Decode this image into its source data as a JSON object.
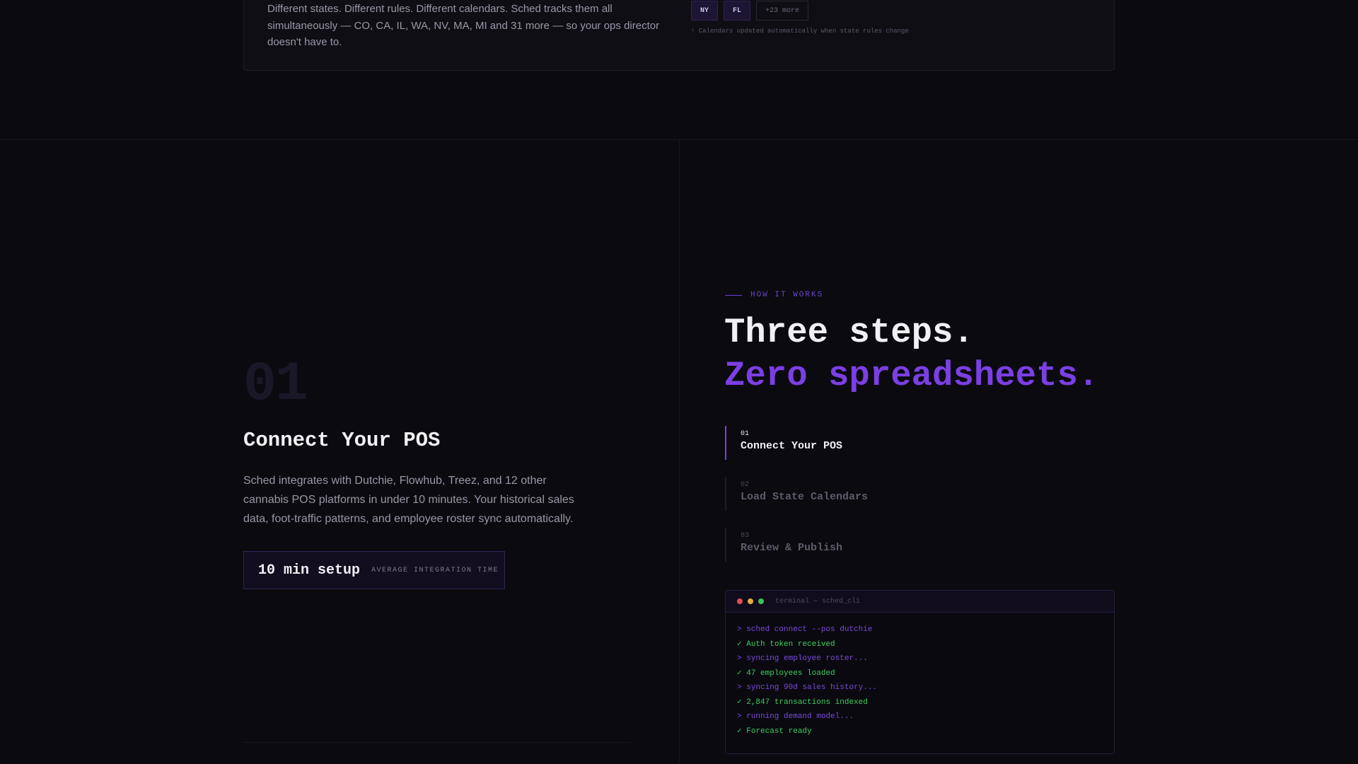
{
  "states_card": {
    "description": "Different states. Different rules. Different calendars. Sched tracks them all simultaneously — CO, CA, IL, WA, NV, MA, MI and 31 more — so your ops director doesn't have to.",
    "chips": [
      "NY",
      "FL"
    ],
    "more_chip": "+23 more",
    "note": "↑ Calendars updated automatically when state rules change"
  },
  "detail": {
    "number": "01",
    "title": "Connect Your POS",
    "description": "Sched integrates with Dutchie, Flowhub, Treez, and 12 other cannabis POS platforms in under 10 minutes. Your historical sales data, foot-traffic patterns, and employee roster sync automatically.",
    "stat_value": "10 min setup",
    "stat_label": "AVERAGE INTEGRATION TIME"
  },
  "how": {
    "eyebrow": "HOW IT WORKS",
    "headline_line1": "Three steps.",
    "headline_line2": "Zero spreadsheets.",
    "steps": [
      {
        "num": "01",
        "title": "Connect Your POS",
        "active": true
      },
      {
        "num": "02",
        "title": "Load State Calendars",
        "active": false
      },
      {
        "num": "03",
        "title": "Review & Publish",
        "active": false
      }
    ]
  },
  "terminal": {
    "title": "terminal — sched_cli",
    "lines": [
      {
        "type": "cmd",
        "text": "> sched connect --pos dutchie"
      },
      {
        "type": "ok",
        "text": "✓ Auth token received"
      },
      {
        "type": "cmd",
        "text": "> syncing employee roster..."
      },
      {
        "type": "ok",
        "text": "✓ 47 employees loaded"
      },
      {
        "type": "cmd",
        "text": "> syncing 90d sales history..."
      },
      {
        "type": "ok",
        "text": "✓ 2,847 transactions indexed"
      },
      {
        "type": "cmd",
        "text": "> running demand model..."
      },
      {
        "type": "ok",
        "text": "✓ Forecast ready"
      }
    ]
  },
  "colors": {
    "accent": "#7b3fe4",
    "success": "#3ecf5c",
    "background": "#0b0a0f"
  }
}
